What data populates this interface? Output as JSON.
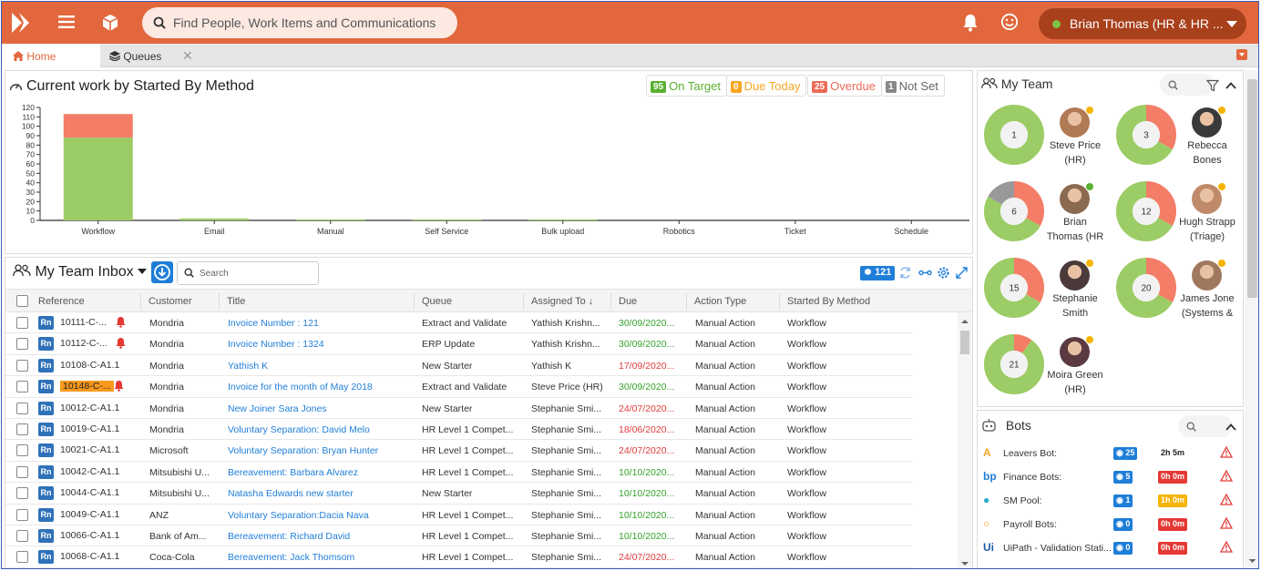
{
  "header": {
    "search_placeholder": "Find People, Work Items and Communications",
    "user_name": "Brian Thomas (HR & HR ..."
  },
  "tabs": [
    {
      "label": "Home",
      "active": true
    },
    {
      "label": "Queues",
      "active": false
    }
  ],
  "chart_panel": {
    "title": "Current work by Started By Method",
    "badges": [
      {
        "count": "95",
        "label": "On Target",
        "color": "#5ab030"
      },
      {
        "count": "0",
        "label": "Due Today",
        "color": "#f5a623"
      },
      {
        "count": "25",
        "label": "Overdue",
        "color": "#ec6b57"
      },
      {
        "count": "1",
        "label": "Not Set",
        "color": "#888888"
      }
    ]
  },
  "chart_data": {
    "type": "bar",
    "categories": [
      "Workflow",
      "Email",
      "Manual",
      "Self Service",
      "Bulk upload",
      "Robotics",
      "Ticket",
      "Schedule"
    ],
    "series": [
      {
        "name": "On Target",
        "color": "#9ccc65",
        "values": [
          88,
          2,
          1,
          1,
          1,
          0,
          0,
          0
        ]
      },
      {
        "name": "Overdue",
        "color": "#f47d67",
        "values": [
          25,
          0,
          0,
          0,
          0,
          0,
          0,
          0
        ]
      }
    ],
    "yticks": [
      0,
      10,
      20,
      30,
      40,
      50,
      60,
      70,
      80,
      90,
      100,
      110,
      120
    ],
    "ylim": [
      0,
      120
    ]
  },
  "inbox": {
    "title": "My Team Inbox",
    "search_placeholder": "Search",
    "count": "121",
    "columns": [
      "Reference",
      "Customer",
      "Title",
      "Queue",
      "Assigned To",
      "Due",
      "Action Type",
      "Started By Method"
    ],
    "rows": [
      {
        "ref": "10111-C-...",
        "alarm": true,
        "hl": false,
        "customer": "Mondria",
        "title": "Invoice Number : 121",
        "queue": "Extract and Validate",
        "assigned": "Yathish Krishn...",
        "due": "30/09/2020...",
        "due_color": "green",
        "action": "Manual Action",
        "method": "Workflow"
      },
      {
        "ref": "10112-C-...",
        "alarm": true,
        "hl": false,
        "customer": "Mondria",
        "title": "Invoice Number : 1324",
        "queue": "ERP Update",
        "assigned": "Yathish Krishn...",
        "due": "30/09/2020...",
        "due_color": "green",
        "action": "Manual Action",
        "method": "Workflow"
      },
      {
        "ref": "10108-C-A1.1",
        "alarm": false,
        "hl": false,
        "customer": "Mondria",
        "title": "Yathish K",
        "queue": "New Starter",
        "assigned": "Yathish K",
        "due": "17/09/2020...",
        "due_color": "red",
        "action": "Manual Action",
        "method": "Workflow"
      },
      {
        "ref": "10148-C-...",
        "alarm": true,
        "hl": true,
        "customer": "Mondria",
        "title": "Invoice for the month of May 2018",
        "queue": "Extract and Validate",
        "assigned": "Steve Price (HR)",
        "due": "30/09/2020...",
        "due_color": "green",
        "action": "Manual Action",
        "method": "Workflow"
      },
      {
        "ref": "10012-C-A1.1",
        "alarm": false,
        "hl": false,
        "customer": "Mondria",
        "title": "New Joiner Sara Jones",
        "queue": "New Starter",
        "assigned": "Stephanie Smi...",
        "due": "24/07/2020...",
        "due_color": "red",
        "action": "Manual Action",
        "method": "Workflow"
      },
      {
        "ref": "10019-C-A1.1",
        "alarm": false,
        "hl": false,
        "customer": "Mondria",
        "title": "Voluntary Separation: David Melo",
        "queue": "HR Level 1 Compet...",
        "assigned": "Stephanie Smi...",
        "due": "18/06/2020...",
        "due_color": "red",
        "action": "Manual Action",
        "method": "Workflow"
      },
      {
        "ref": "10021-C-A1.1",
        "alarm": false,
        "hl": false,
        "customer": "Microsoft",
        "title": "Voluntary Separation: Bryan Hunter",
        "queue": "HR Level 1 Compet...",
        "assigned": "Stephanie Smi...",
        "due": "24/07/2020...",
        "due_color": "red",
        "action": "Manual Action",
        "method": "Workflow"
      },
      {
        "ref": "10042-C-A1.1",
        "alarm": false,
        "hl": false,
        "customer": "Mitsubishi U...",
        "title": "Bereavement: Barbara Alvarez",
        "queue": "HR Level 1 Compet...",
        "assigned": "Stephanie Smi...",
        "due": "10/10/2020...",
        "due_color": "green",
        "action": "Manual Action",
        "method": "Workflow"
      },
      {
        "ref": "10044-C-A1.1",
        "alarm": false,
        "hl": false,
        "customer": "Mitsubishi U...",
        "title": "Natasha Edwards new starter",
        "queue": "New Starter",
        "assigned": "Stephanie Smi...",
        "due": "10/10/2020...",
        "due_color": "green",
        "action": "Manual Action",
        "method": "Workflow"
      },
      {
        "ref": "10049-C-A1.1",
        "alarm": false,
        "hl": false,
        "customer": "ANZ",
        "title": "Voluntary Separation:Dacia Nava",
        "queue": "HR Level 1 Compet...",
        "assigned": "Stephanie Smi...",
        "due": "10/10/2020...",
        "due_color": "green",
        "action": "Manual Action",
        "method": "Workflow"
      },
      {
        "ref": "10066-C-A1.1",
        "alarm": false,
        "hl": false,
        "customer": "Bank of Am...",
        "title": "Bereavement: Richard David",
        "queue": "HR Level 1 Compet...",
        "assigned": "Stephanie Smi...",
        "due": "10/10/2020...",
        "due_color": "green",
        "action": "Manual Action",
        "method": "Workflow"
      },
      {
        "ref": "10068-C-A1.1",
        "alarm": false,
        "hl": false,
        "customer": "Coca-Cola",
        "title": "Bereavement: Jack Thomsom",
        "queue": "HR Level 1 Compet...",
        "assigned": "Stephanie Smi...",
        "due": "24/07/2020...",
        "due_color": "red",
        "action": "Manual Action",
        "method": "Workflow"
      }
    ]
  },
  "team": {
    "title": "My Team",
    "members": [
      {
        "name": "Steve Price (HR)",
        "lines": [
          "Steve Price",
          "(HR)"
        ],
        "count": "1",
        "status": "#f5b400",
        "fractions": {
          "on_target": 1.0,
          "overdue": 0.0,
          "unset": 0.0
        },
        "avatar_color": "#b07a55"
      },
      {
        "name": "Rebecca Bones",
        "lines": [
          "Rebecca",
          "Bones"
        ],
        "count": "3",
        "status": "#f5b400",
        "fractions": {
          "on_target": 0.67,
          "overdue": 0.33,
          "unset": 0.0
        },
        "avatar_color": "#3a3a3a"
      },
      {
        "name": "Brian Thomas (HR",
        "lines": [
          "Brian",
          "Thomas (HR"
        ],
        "count": "6",
        "status": "#5ab030",
        "fractions": {
          "on_target": 0.5,
          "overdue": 0.33,
          "unset": 0.17
        },
        "avatar_color": "#8a6a50"
      },
      {
        "name": "Hugh Strapp (Triage)",
        "lines": [
          "Hugh Strapp",
          "(Triage)"
        ],
        "count": "12",
        "status": "#f5b400",
        "fractions": {
          "on_target": 0.67,
          "overdue": 0.33,
          "unset": 0.0
        },
        "avatar_color": "#c08a6a"
      },
      {
        "name": "Stephanie Smith",
        "lines": [
          "Stephanie",
          "Smith"
        ],
        "count": "15",
        "status": "#f5b400",
        "fractions": {
          "on_target": 0.67,
          "overdue": 0.33,
          "unset": 0.0
        },
        "avatar_color": "#4a3a3a"
      },
      {
        "name": "James Jone (Systems &",
        "lines": [
          "James Jone",
          "(Systems &"
        ],
        "count": "20",
        "status": "#f5b400",
        "fractions": {
          "on_target": 0.67,
          "overdue": 0.33,
          "unset": 0.0
        },
        "avatar_color": "#a07860"
      },
      {
        "name": "Moira Green (HR)",
        "lines": [
          "Moira Green",
          "(HR)"
        ],
        "count": "21",
        "status": "#f5b400",
        "fractions": {
          "on_target": 0.9,
          "overdue": 0.1,
          "unset": 0.0
        },
        "avatar_color": "#5a3a40"
      }
    ]
  },
  "bots": {
    "title": "Bots",
    "items": [
      {
        "name": "Leavers Bot:",
        "icon": "A",
        "icon_color": "#f5a623",
        "count": "25",
        "time": "2h 5m",
        "time_bg": "#ffffff",
        "time_fg": "#222222"
      },
      {
        "name": "Finance Bots:",
        "icon": "bp",
        "icon_color": "#1f7ed8",
        "count": "5",
        "time": "0h 0m",
        "time_bg": "#e53935",
        "time_fg": "#ffffff"
      },
      {
        "name": "SM Pool:",
        "icon": "●",
        "icon_color": "#2aa9c9",
        "count": "1",
        "time": "1h 0m",
        "time_bg": "#f5b400",
        "time_fg": "#ffffff"
      },
      {
        "name": "Payroll Bots:",
        "icon": "○",
        "icon_color": "#f5a623",
        "count": "0",
        "time": "0h 0m",
        "time_bg": "#e53935",
        "time_fg": "#ffffff"
      },
      {
        "name": "UiPath - Validation Stati...",
        "icon": "Ui",
        "icon_color": "#1f5aa8",
        "count": "0",
        "time": "0h 0m",
        "time_bg": "#e53935",
        "time_fg": "#ffffff"
      }
    ]
  }
}
